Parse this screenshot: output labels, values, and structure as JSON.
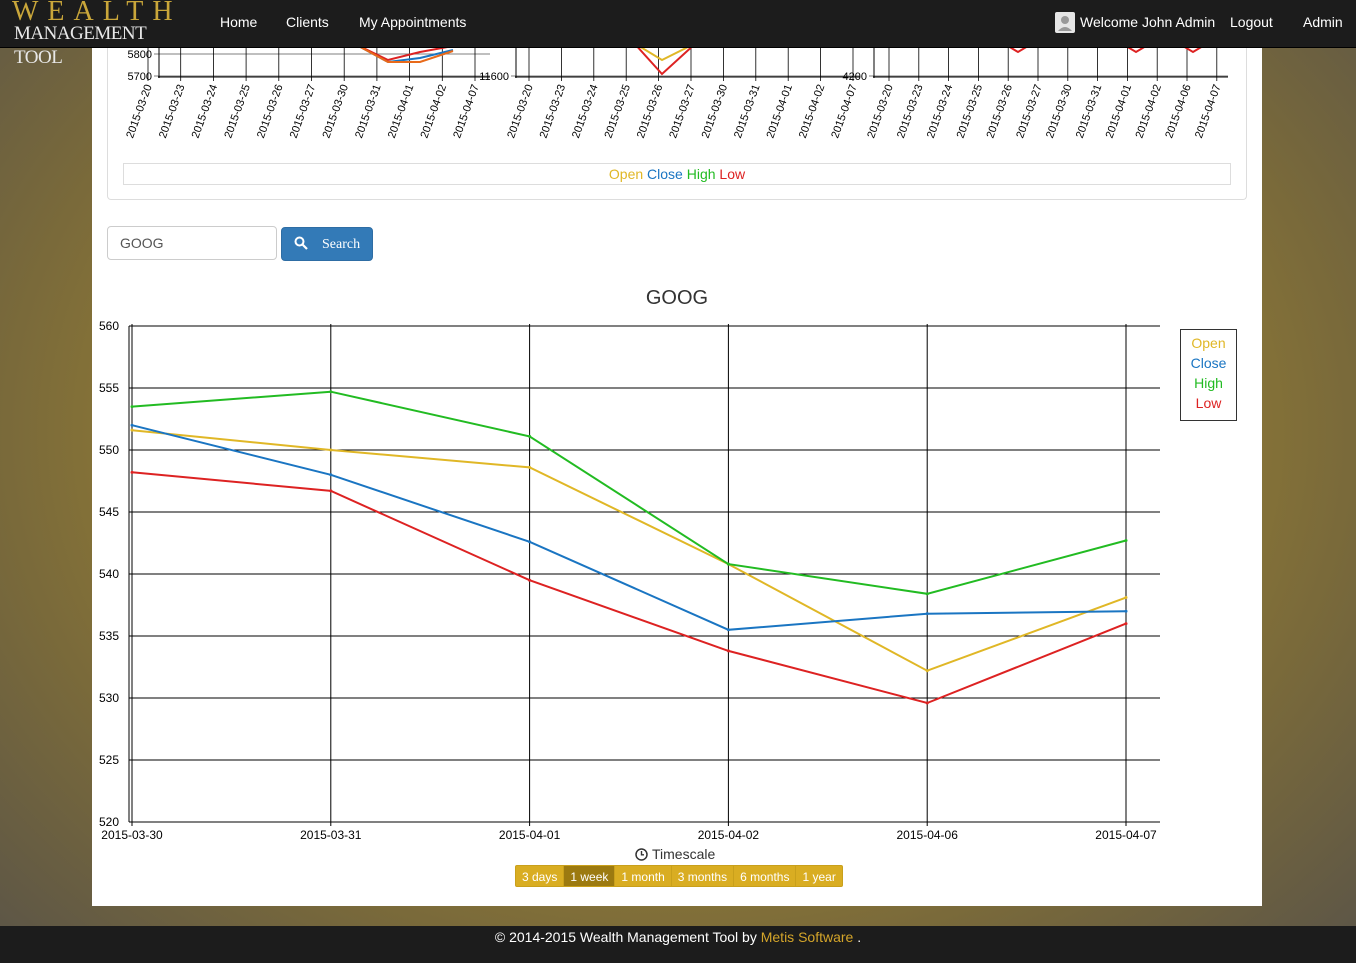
{
  "navbar": {
    "brand_top": "WEALTH",
    "brand_bottom": "MANAGEMENT TOOL",
    "links": [
      "Home",
      "Clients",
      "My Appointments"
    ],
    "welcome": "Welcome John Admin",
    "logout": "Logout",
    "admin": "Admin"
  },
  "top_charts": {
    "legend": [
      "Open",
      "Close",
      "High",
      "Low"
    ],
    "chart1": {
      "y_ticks": [
        "5800",
        "5700"
      ],
      "dates": [
        "2015-03-20",
        "2015-03-23",
        "2015-03-24",
        "2015-03-25",
        "2015-03-26",
        "2015-03-27",
        "2015-03-30",
        "2015-03-31",
        "2015-04-01",
        "2015-04-02",
        "2015-04-07"
      ]
    },
    "chart2": {
      "y_ticks": [
        "11600"
      ],
      "dates": [
        "2015-03-20",
        "2015-03-23",
        "2015-03-24",
        "2015-03-25",
        "2015-03-26",
        "2015-03-27",
        "2015-03-30",
        "2015-03-31",
        "2015-04-01",
        "2015-04-02",
        "2015-04-07"
      ]
    },
    "chart3": {
      "y_ticks": [
        "4200"
      ],
      "dates": [
        "2015-03-20",
        "2015-03-23",
        "2015-03-24",
        "2015-03-25",
        "2015-03-26",
        "2015-03-27",
        "2015-03-30",
        "2015-03-31",
        "2015-04-01",
        "2015-04-02",
        "2015-04-06",
        "2015-04-07"
      ]
    }
  },
  "search": {
    "value": "GOOG",
    "button_label": "Search"
  },
  "chart_data": {
    "type": "line",
    "title": "GOOG",
    "x": [
      "2015-03-30",
      "2015-03-31",
      "2015-04-01",
      "2015-04-02",
      "2015-04-06",
      "2015-04-07"
    ],
    "series": [
      {
        "name": "Open",
        "color": "#e0b726",
        "values": [
          551.6,
          550.0,
          548.6,
          540.8,
          532.2,
          538.1
        ]
      },
      {
        "name": "Close",
        "color": "#1a75c2",
        "values": [
          552.0,
          548.0,
          542.6,
          535.5,
          536.8,
          537.0
        ]
      },
      {
        "name": "High",
        "color": "#22bb22",
        "values": [
          553.5,
          554.7,
          551.1,
          540.8,
          538.4,
          542.7
        ]
      },
      {
        "name": "Low",
        "color": "#dd2222",
        "values": [
          548.2,
          546.7,
          539.5,
          533.8,
          529.6,
          536.0
        ]
      }
    ],
    "y_ticks": [
      560,
      555,
      550,
      545,
      540,
      535,
      530,
      525,
      520
    ],
    "ylim": [
      520,
      560
    ],
    "grid": true,
    "legend_position": "right"
  },
  "timescale": {
    "label": "Timescale",
    "buttons": [
      "3 days",
      "1 week",
      "1 month",
      "3 months",
      "6 months",
      "1 year"
    ],
    "active": "1 week"
  },
  "footer": {
    "prefix": "© 2014-2015 Wealth Management Tool by",
    "link": "Metis Software",
    "suffix": "."
  }
}
